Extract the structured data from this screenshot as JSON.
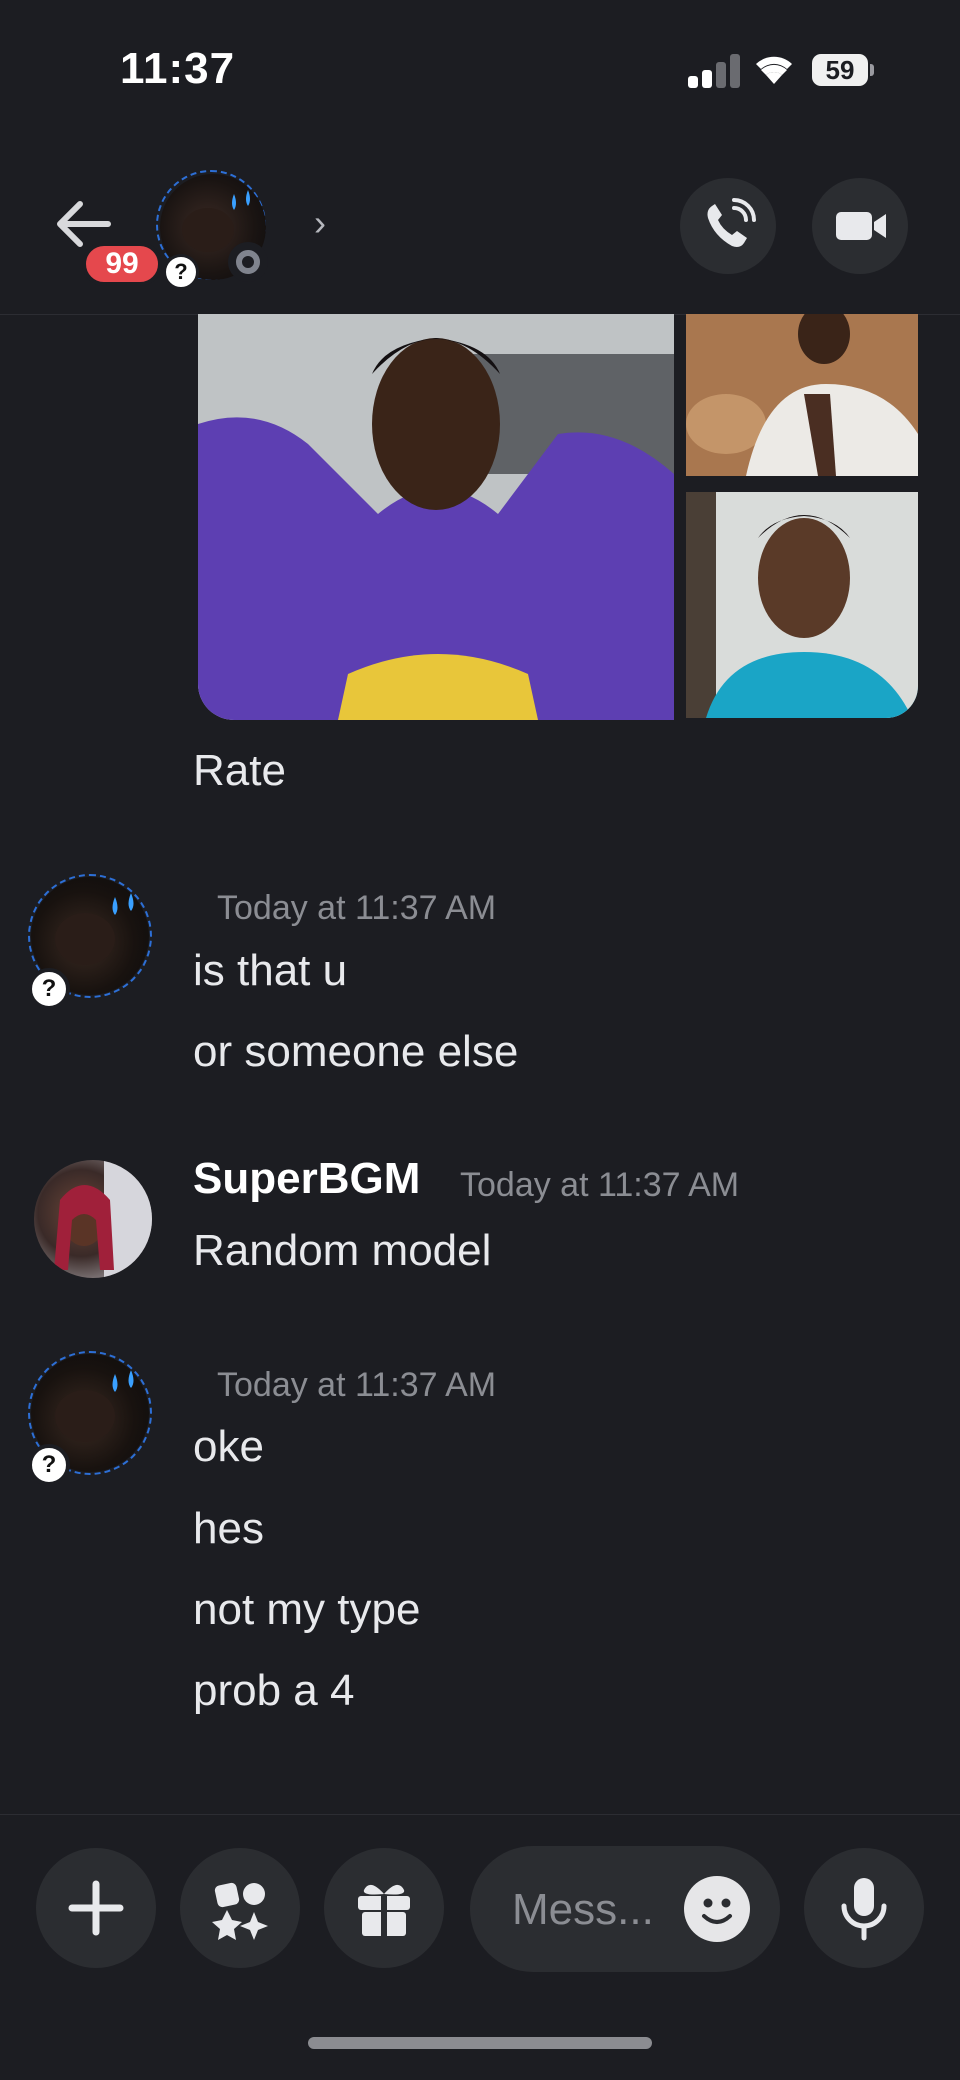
{
  "status_bar": {
    "time": "11:37",
    "battery": "59"
  },
  "header": {
    "unread_badge": "99",
    "chevron": "›"
  },
  "messages": {
    "m1": {
      "text": "Rate"
    },
    "m2": {
      "timestamp": "Today at 11:37 AM",
      "lines": [
        "is that u",
        "or someone else"
      ]
    },
    "m3": {
      "author": "SuperBGM",
      "timestamp": "Today at 11:37 AM",
      "lines": [
        "Random model"
      ]
    },
    "m4": {
      "timestamp": "Today at 11:37 AM",
      "lines": [
        "oke",
        "hes",
        "not my type",
        "prob a 4"
      ]
    }
  },
  "composer": {
    "placeholder": "Mess..."
  },
  "icons": {
    "back": "back-arrow-icon",
    "call": "phone-call-icon",
    "video": "video-camera-icon",
    "add": "plus-icon",
    "apps": "apps-icon",
    "gift": "gift-icon",
    "emoji": "emoji-icon",
    "mic": "microphone-icon"
  },
  "colors": {
    "background": "#1c1d22",
    "badge_red": "#e5484d",
    "button_bg": "#2b2d31",
    "muted_text": "#8b8d93"
  }
}
